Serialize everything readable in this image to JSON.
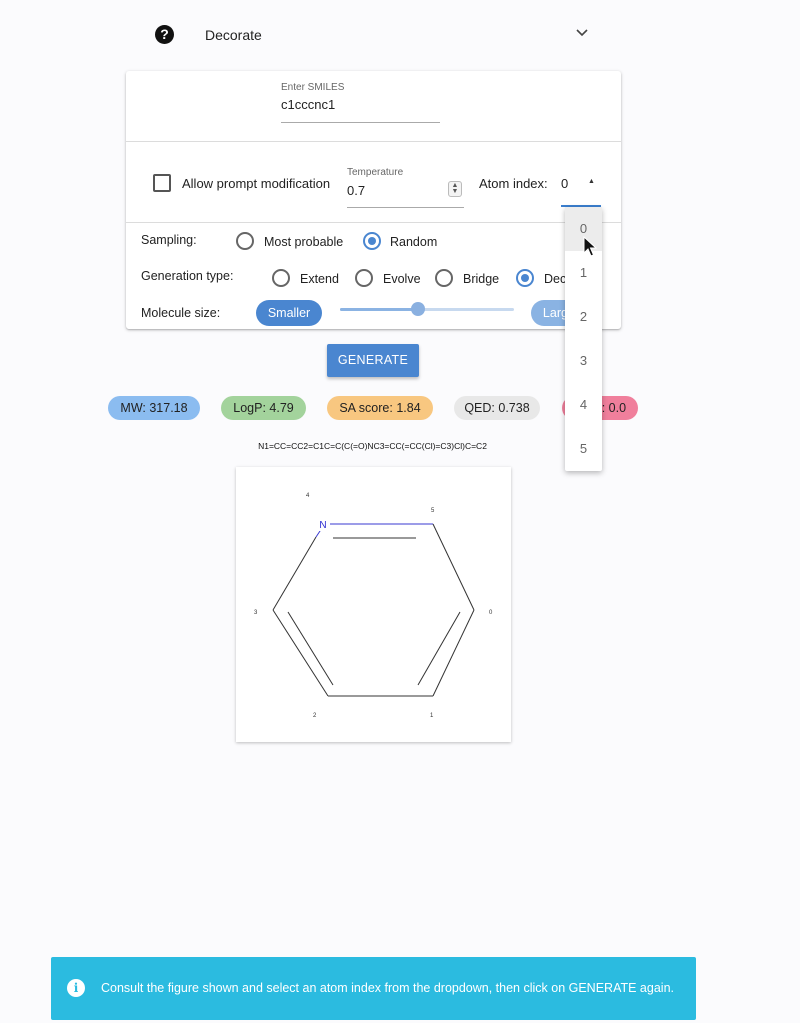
{
  "header": {
    "help_icon": "?",
    "title": "Decorate",
    "chevron_icon": "chevron-down-icon"
  },
  "smiles_input": {
    "label": "Enter SMILES",
    "value": "c1cccnc1"
  },
  "options": {
    "allow_prompt_label": "Allow prompt modification",
    "allow_prompt_checked": false,
    "temperature_label": "Temperature",
    "temperature_value": "0.7",
    "atom_index_label": "Atom index:",
    "atom_index_value": "0"
  },
  "sampling": {
    "label": "Sampling:",
    "options": [
      {
        "label": "Most probable",
        "checked": false
      },
      {
        "label": "Random",
        "checked": true
      }
    ]
  },
  "generation_type": {
    "label": "Generation type:",
    "options": [
      {
        "label": "Extend",
        "checked": false
      },
      {
        "label": "Evolve",
        "checked": false
      },
      {
        "label": "Bridge",
        "checked": false
      },
      {
        "label": "Decorate",
        "checked": true
      }
    ]
  },
  "molecule_size": {
    "label": "Molecule size:",
    "smaller_label": "Smaller",
    "larger_label": "Larger",
    "level": 0.45
  },
  "generate_label": "GENERATE",
  "chips": [
    {
      "label": "MW: 317.18",
      "color": "#8bbcf0"
    },
    {
      "label": "LogP: 4.79",
      "color": "#a3d39c"
    },
    {
      "label": "SA score: 1.84",
      "color": "#f8c780"
    },
    {
      "label": "QED: 0.738",
      "color": "#e8e8e8"
    },
    {
      "label": "Fsp3: 0.0",
      "color": "#f07f9c"
    }
  ],
  "result_smiles": "N1=CC=CC2=C1C=C(C(=O)NC3=CC(=CC(Cl)=C3)Cl)C=C2",
  "molecule": {
    "atom_symbol": "N",
    "atom_indices": [
      "4",
      "5",
      "3",
      "0",
      "2",
      "1"
    ]
  },
  "dropdown": {
    "options": [
      "0",
      "1",
      "2",
      "3",
      "4",
      "5"
    ],
    "selected": "0"
  },
  "snackbar": {
    "icon": "i",
    "text": "Consult the figure shown and select an atom index from the dropdown, then click on GENERATE again."
  },
  "colors": {
    "primary": "#4a86d0",
    "snackbar": "#2bbbe0"
  }
}
